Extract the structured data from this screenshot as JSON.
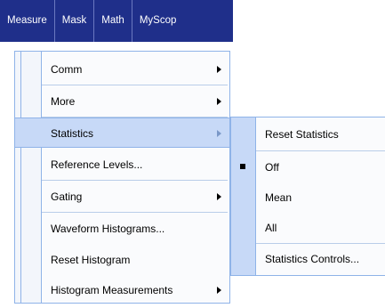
{
  "menubar": {
    "items": [
      {
        "label": "Measure"
      },
      {
        "label": "Mask"
      },
      {
        "label": "Math"
      },
      {
        "label": "MyScop"
      }
    ]
  },
  "menu": {
    "items": [
      {
        "label": "Comm",
        "has_submenu": true
      },
      {
        "label": "More",
        "has_submenu": true
      },
      {
        "label": "Statistics",
        "has_submenu": true,
        "highlighted": true
      },
      {
        "label": "Reference Levels...",
        "has_submenu": false
      },
      {
        "label": "Gating",
        "has_submenu": true
      },
      {
        "label": "Waveform Histograms...",
        "has_submenu": false
      },
      {
        "label": "Reset Histogram",
        "has_submenu": false
      },
      {
        "label": "Histogram Measurements",
        "has_submenu": true
      }
    ]
  },
  "submenu": {
    "items": [
      {
        "label": "Reset Statistics",
        "selected": false
      },
      {
        "label": "Off",
        "selected": true
      },
      {
        "label": "Mean",
        "selected": false
      },
      {
        "label": "All",
        "selected": false
      },
      {
        "label": "Statistics Controls...",
        "selected": false
      }
    ]
  },
  "colors": {
    "menubar_bg": "#1f2f8a",
    "highlight_bg": "#c7d9f7",
    "menu_border": "#8fb3e8"
  }
}
